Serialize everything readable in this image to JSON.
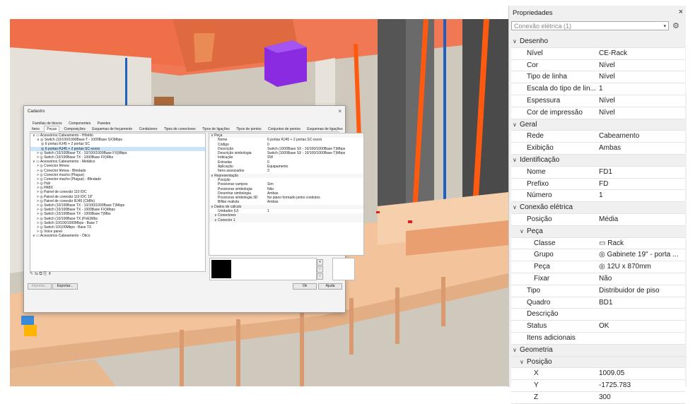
{
  "dialog": {
    "title": "Cadastro",
    "close_icon": "close-icon",
    "tabs_row1": [
      "Famílias de blocos",
      "Componentes",
      "Paredes"
    ],
    "tabs_row2": [
      "Itens",
      "Peças",
      "Composições",
      "Esquemas de forçamento",
      "Condutores",
      "Tipos de conectores",
      "Tipos de ligações",
      "Tipos de pontos",
      "Conjuntos de pontos",
      "Esquemas de ligações"
    ],
    "active_tab": "Peças",
    "tree": [
      {
        "indent": 0,
        "icon": "folder",
        "label": "Acessórios Cabeamento - Híbrido"
      },
      {
        "indent": 1,
        "icon": "part",
        "label": "Switch (10/100/1000Base T - 1000Base SX)Mbps"
      },
      {
        "indent": 2,
        "icon": "part",
        "label": "6 portas RJ45 + 2 portas SC"
      },
      {
        "indent": 2,
        "icon": "part",
        "label": "6 portas RJ45 + 2 portas SC-xxxxx",
        "selected": true
      },
      {
        "indent": 1,
        "icon": "part",
        "label": "Switch (10/100Base TX - 10/100/1000Base FX)Mbps"
      },
      {
        "indent": 1,
        "icon": "part",
        "label": "Switch (10/100Base TX - 1000Base FX)Mbs"
      },
      {
        "indent": 0,
        "icon": "folder",
        "label": "Acessórios Cabeamento - Metálico"
      },
      {
        "indent": 1,
        "icon": "part",
        "label": "Conector fêmea"
      },
      {
        "indent": 1,
        "icon": "part",
        "label": "Conector fêmea - Blindado"
      },
      {
        "indent": 1,
        "icon": "part",
        "label": "Conector macho (Plague)"
      },
      {
        "indent": 1,
        "icon": "part",
        "label": "Conector macho (Plague) - Blindado"
      },
      {
        "indent": 1,
        "icon": "part",
        "label": "Hub"
      },
      {
        "indent": 1,
        "icon": "part",
        "label": "PABX"
      },
      {
        "indent": 1,
        "icon": "part",
        "label": "Painel de conexão 110 IDC"
      },
      {
        "indent": 1,
        "icon": "part",
        "label": "Painel de conexão 110 IDC 19\""
      },
      {
        "indent": 1,
        "icon": "part",
        "label": "Painel de conexão RJ45 (CM8v)"
      },
      {
        "indent": 1,
        "icon": "part",
        "label": "Switch (10/100Base TX - 10/100/1000Base T)Mbps"
      },
      {
        "indent": 1,
        "icon": "part",
        "label": "Switch (10/100Base TX - 1000Base FX)Mbps"
      },
      {
        "indent": 1,
        "icon": "part",
        "label": "Switch (10/100Base TX - 1000Base T)Mbs"
      },
      {
        "indent": 1,
        "icon": "part",
        "label": "Switch (10/100Base TX (PoE)Mbs"
      },
      {
        "indent": 1,
        "icon": "part",
        "label": "Switch 10/100/1000Mbps - Base T"
      },
      {
        "indent": 1,
        "icon": "part",
        "label": "Switch 10/100Mbps - Base TX"
      },
      {
        "indent": 1,
        "icon": "part",
        "label": "Voice panel"
      },
      {
        "indent": 0,
        "icon": "folder",
        "label": "Acessórios Cabeamento - Ótico"
      }
    ],
    "tree_toolbar": "✎ ⇆ ⧉ ⎘   ⇟",
    "props": [
      {
        "section": true,
        "label": "Peça"
      },
      {
        "k": "Nome",
        "v": "6 portas RJ45 + 2 portas SC-xxxxx"
      },
      {
        "k": "Código",
        "v": "0"
      },
      {
        "k": "Descrição",
        "v": "Switch (1000Base SX - 10/100/1000Base T)Mbps"
      },
      {
        "k": "Descrição simbologia",
        "v": "Switch (1000Base SX - 10/100/1000Base T)Mbps"
      },
      {
        "k": "Indicação",
        "v": "SW"
      },
      {
        "k": "Entradas",
        "v": "0"
      },
      {
        "k": "Aplicação",
        "v": "Equipamento"
      },
      {
        "k": "Itens associados",
        "v": "3"
      },
      {
        "section": true,
        "label": "Representação"
      },
      {
        "k": "Posição",
        "v": ""
      },
      {
        "k": "Posicionar campos",
        "v": "Sim"
      },
      {
        "k": "Posicionar simbologia",
        "v": "Não"
      },
      {
        "k": "Desenhar simbologia",
        "v": "Ambas"
      },
      {
        "k": "Posicionar simbologia 3D",
        "v": "No plano formado pelos condutos"
      },
      {
        "k": "Bifilar realista",
        "v": "Ambas"
      },
      {
        "section": true,
        "label": "Dados de cálculo"
      },
      {
        "k": "Unidades (U)",
        "v": "1"
      },
      {
        "section": true,
        "label": "Conectores",
        "sub": true
      },
      {
        "section": true,
        "label": "Conector 1",
        "sub": true
      }
    ],
    "buttons": {
      "import": "Importar...",
      "export": "Exportar...",
      "ok": "Ok",
      "help": "Ajuda"
    }
  },
  "panel": {
    "title": "Propriedades",
    "selection": "Conexão elétrica (1)",
    "rows": [
      {
        "type": "sec",
        "level": 0,
        "label": "Desenho"
      },
      {
        "level": 1,
        "k": "Nível",
        "v": "CE-Rack"
      },
      {
        "level": 1,
        "k": "Cor",
        "v": "Nível"
      },
      {
        "level": 1,
        "k": "Tipo de linha",
        "v": "Nível"
      },
      {
        "level": 1,
        "k": "Escala do tipo de lin...",
        "v": "1"
      },
      {
        "level": 1,
        "k": "Espessura",
        "v": "Nível"
      },
      {
        "level": 1,
        "k": "Cor de impressão",
        "v": "Nível"
      },
      {
        "type": "sec",
        "level": 0,
        "label": "Geral"
      },
      {
        "level": 1,
        "k": "Rede",
        "v": "Cabeamento"
      },
      {
        "level": 1,
        "k": "Exibição",
        "v": "Ambas"
      },
      {
        "type": "sec",
        "level": 0,
        "label": "Identificação"
      },
      {
        "level": 1,
        "k": "Nome",
        "v": "FD1"
      },
      {
        "level": 1,
        "k": "Prefixo",
        "v": "FD"
      },
      {
        "level": 1,
        "k": "Número",
        "v": "1"
      },
      {
        "type": "sec",
        "level": 0,
        "label": "Conexão elétrica"
      },
      {
        "level": 1,
        "k": "Posição",
        "v": "Média"
      },
      {
        "type": "sec",
        "level": 1,
        "label": "Peça"
      },
      {
        "level": 2,
        "k": "Classe",
        "v": "Rack",
        "icon": "rack-icon"
      },
      {
        "level": 2,
        "k": "Grupo",
        "v": "Gabinete 19\" - porta ...",
        "icon": "part-icon"
      },
      {
        "level": 2,
        "k": "Peça",
        "v": "12U x 870mm",
        "icon": "part-icon"
      },
      {
        "level": 2,
        "k": "Fixar",
        "v": "Não"
      },
      {
        "level": 1,
        "k": "Tipo",
        "v": "Distribuidor de piso"
      },
      {
        "level": 1,
        "k": "Quadro",
        "v": "BD1"
      },
      {
        "level": 1,
        "k": "Descrição",
        "v": ""
      },
      {
        "level": 1,
        "k": "Status",
        "v": "OK"
      },
      {
        "level": 1,
        "k": "Itens adicionais",
        "v": ""
      },
      {
        "type": "sec",
        "level": 0,
        "label": "Geometria"
      },
      {
        "type": "sec",
        "level": 1,
        "label": "Posição"
      },
      {
        "level": 2,
        "k": "X",
        "v": "1009.05"
      },
      {
        "level": 2,
        "k": "Y",
        "v": "-1725.783"
      },
      {
        "level": 2,
        "k": "Z",
        "v": "300"
      }
    ]
  },
  "colors": {
    "ceiling": "#f0734e",
    "beam": "#ff6a2c",
    "duct": "#e8c2a0",
    "column": "#4d4d4d",
    "rack": "#8a2be2",
    "cable_blue": "#1f5fbf",
    "cable_orange": "#ff5a10",
    "selection": "#cce4f7"
  }
}
